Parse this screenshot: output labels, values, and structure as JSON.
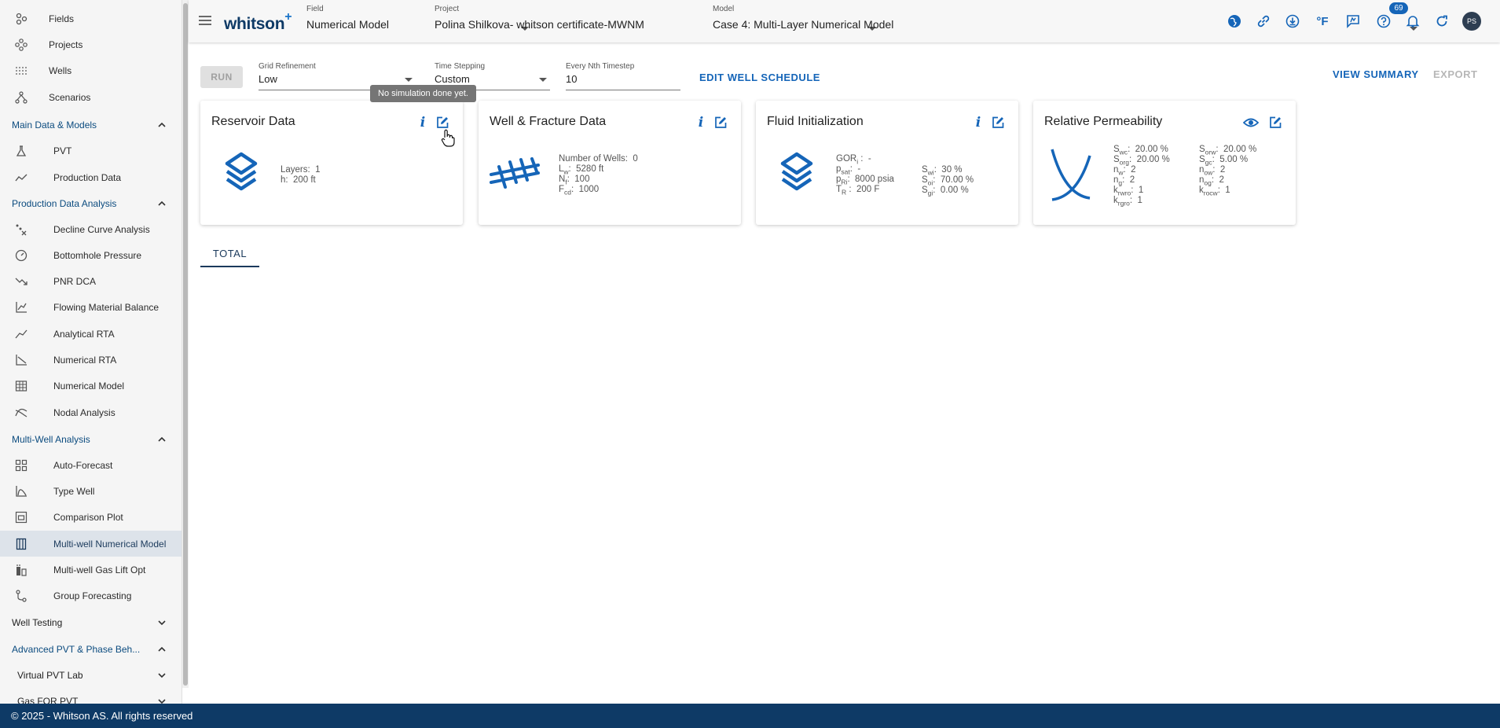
{
  "sidebar": {
    "top_items": [
      {
        "label": "Fields",
        "icon": "fields-icon"
      },
      {
        "label": "Projects",
        "icon": "projects-icon"
      },
      {
        "label": "Wells",
        "icon": "wells-icon"
      },
      {
        "label": "Scenarios",
        "icon": "scenarios-icon"
      }
    ],
    "sections": {
      "main": "Main Data & Models",
      "pda": "Production Data Analysis",
      "multi": "Multi-Well Analysis",
      "testing": "Well Testing",
      "advanced": "Advanced PVT & Phase Beh..."
    },
    "main_items": [
      {
        "label": "PVT",
        "icon": "flask-icon"
      },
      {
        "label": "Production Data",
        "icon": "trend-icon"
      }
    ],
    "pda_items": [
      {
        "label": "Decline Curve Analysis",
        "icon": "decline-icon"
      },
      {
        "label": "Bottomhole Pressure",
        "icon": "gauge-icon"
      },
      {
        "label": "PNR DCA",
        "icon": "trending-down-icon"
      },
      {
        "label": "Flowing Material Balance",
        "icon": "chart-icon"
      },
      {
        "label": "Analytical RTA",
        "icon": "line-chart-icon"
      },
      {
        "label": "Numerical RTA",
        "icon": "rta-icon"
      },
      {
        "label": "Numerical Model",
        "icon": "grid-model-icon"
      },
      {
        "label": "Nodal Analysis",
        "icon": "nodal-icon"
      }
    ],
    "multi_items": [
      {
        "label": "Auto-Forecast",
        "icon": "dashboard-icon"
      },
      {
        "label": "Type Well",
        "icon": "type-well-icon"
      },
      {
        "label": "Comparison Plot",
        "icon": "comparison-icon"
      },
      {
        "label": "Multi-well Numerical Model",
        "icon": "multi-model-icon"
      },
      {
        "label": "Multi-well Gas Lift Opt",
        "icon": "gas-lift-icon"
      },
      {
        "label": "Group Forecasting",
        "icon": "group-icon"
      }
    ],
    "advanced_items": [
      {
        "label": "Virtual PVT Lab"
      },
      {
        "label": "Gas FOR PVT"
      }
    ]
  },
  "header": {
    "logo": "whitson",
    "logo_plus": "+",
    "field_caption": "Field",
    "field_value": "Numerical Model",
    "project_caption": "Project",
    "project_value": "Polina Shilkova- whitson certificate-MWNM",
    "model_caption": "Model",
    "model_value": "Case 4: Multi-Layer Numerical Model",
    "temp_unit": "°F",
    "notification_count": "69",
    "avatar_initials": "PS"
  },
  "toolbar": {
    "run_label": "RUN",
    "grid_caption": "Grid Refinement",
    "grid_value": "Low",
    "time_caption": "Time Stepping",
    "time_value": "Custom",
    "nth_caption": "Every Nth Timestep",
    "nth_value": "10",
    "edit_schedule": "EDIT WELL SCHEDULE",
    "view_summary": "VIEW SUMMARY",
    "export": "EXPORT",
    "tooltip": "No simulation done yet."
  },
  "cards": {
    "reservoir": {
      "title": "Reservoir Data",
      "layers_label": "Layers:",
      "layers_value": "1",
      "h_label": "h:",
      "h_value": "200 ft"
    },
    "well": {
      "title": "Well & Fracture Data",
      "wells_label": "Number of Wells:",
      "wells_value": "0",
      "lw_value": "5280 ft",
      "nf_value": "100",
      "fcd_value": "1000"
    },
    "fluid": {
      "title": "Fluid Initialization",
      "gor_value": "-",
      "psat_value": "-",
      "pri_value": "8000 psia",
      "tr_value": "200 F",
      "swi_value": "30 %",
      "soi_value": "70.00 %",
      "sgi_value": "0.00 %"
    },
    "relperm": {
      "title": "Relative Permeability",
      "swc": "20.00 %",
      "sorg": "20.00 %",
      "nw": "2",
      "ng": "2",
      "krwro": "1",
      "krgro": "1",
      "sorw": "20.00 %",
      "sgc": "5.00 %",
      "now": "2",
      "nog": "2",
      "krocw": "1"
    }
  },
  "tabs": [
    {
      "label": "TOTAL"
    }
  ],
  "footer": "© 2025 - Whitson AS. All rights reserved",
  "colors": {
    "primary": "#1565b8",
    "navy": "#0e3a66",
    "active_bg": "#dde3ea"
  }
}
